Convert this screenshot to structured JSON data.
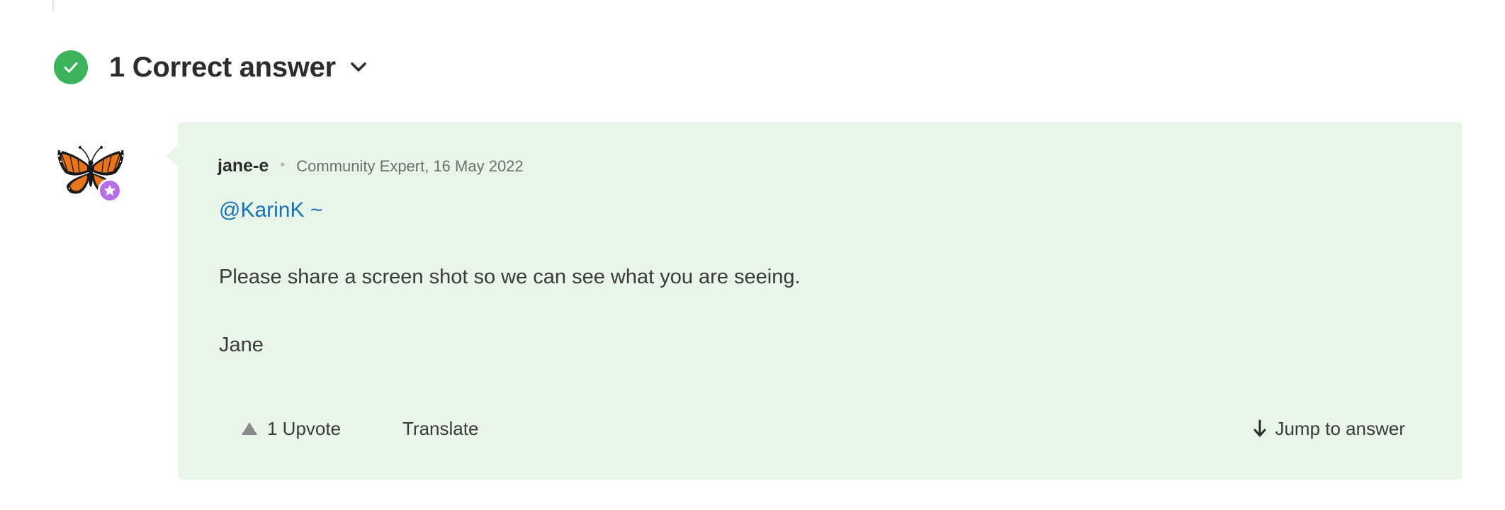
{
  "header": {
    "count_title": "1 Correct answer",
    "icon": "check-circle-icon",
    "toggle_icon": "chevron-down-icon"
  },
  "reply": {
    "author": "jane-e",
    "separator": "•",
    "role_date": "Community Expert, 16 May 2022",
    "mention": "@KarinK ~",
    "body": "Please share a screen shot so we can see what you are seeing.",
    "signature": "Jane",
    "avatar_icon": "monarch-butterfly-icon",
    "badge_icon": "community-expert-star-icon"
  },
  "actions": {
    "upvote_label": "1 Upvote",
    "translate_label": "Translate",
    "jump_label": "Jump to answer"
  },
  "colors": {
    "check_green": "#3cb25a",
    "card_background": "#eaf5ea",
    "mention_blue": "#1473b8",
    "badge_purple": "#b66ee8"
  }
}
